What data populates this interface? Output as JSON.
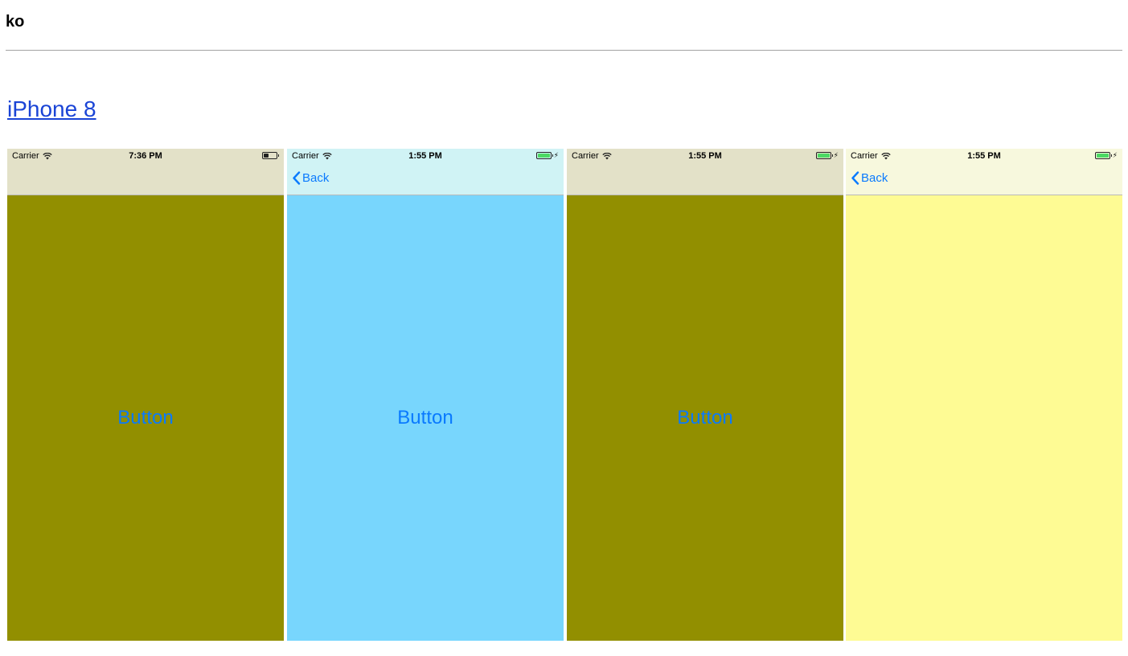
{
  "page": {
    "title": "ko",
    "device_link": "iPhone 8"
  },
  "colors": {
    "tint": "#0a7afe",
    "battery_green": "#4cd964",
    "battery_dark": "#222222"
  },
  "screens": [
    {
      "carrier": "Carrier",
      "time": "7:36 PM",
      "battery_level": 0.4,
      "charging": false,
      "navbar_bg": "#e3e1c8",
      "content_bg": "#928f00",
      "back_label": "",
      "button_label": "Button"
    },
    {
      "carrier": "Carrier",
      "time": "1:55 PM",
      "battery_level": 1.0,
      "charging": true,
      "navbar_bg": "#d0f3f5",
      "content_bg": "#78d6fd",
      "back_label": "Back",
      "button_label": "Button"
    },
    {
      "carrier": "Carrier",
      "time": "1:55 PM",
      "battery_level": 1.0,
      "charging": true,
      "navbar_bg": "#e3e1c8",
      "content_bg": "#928f00",
      "back_label": "",
      "button_label": "Button"
    },
    {
      "carrier": "Carrier",
      "time": "1:55 PM",
      "battery_level": 1.0,
      "charging": true,
      "navbar_bg": "#f7f8dd",
      "content_bg": "#fefb94",
      "back_label": "Back",
      "button_label": ""
    }
  ]
}
